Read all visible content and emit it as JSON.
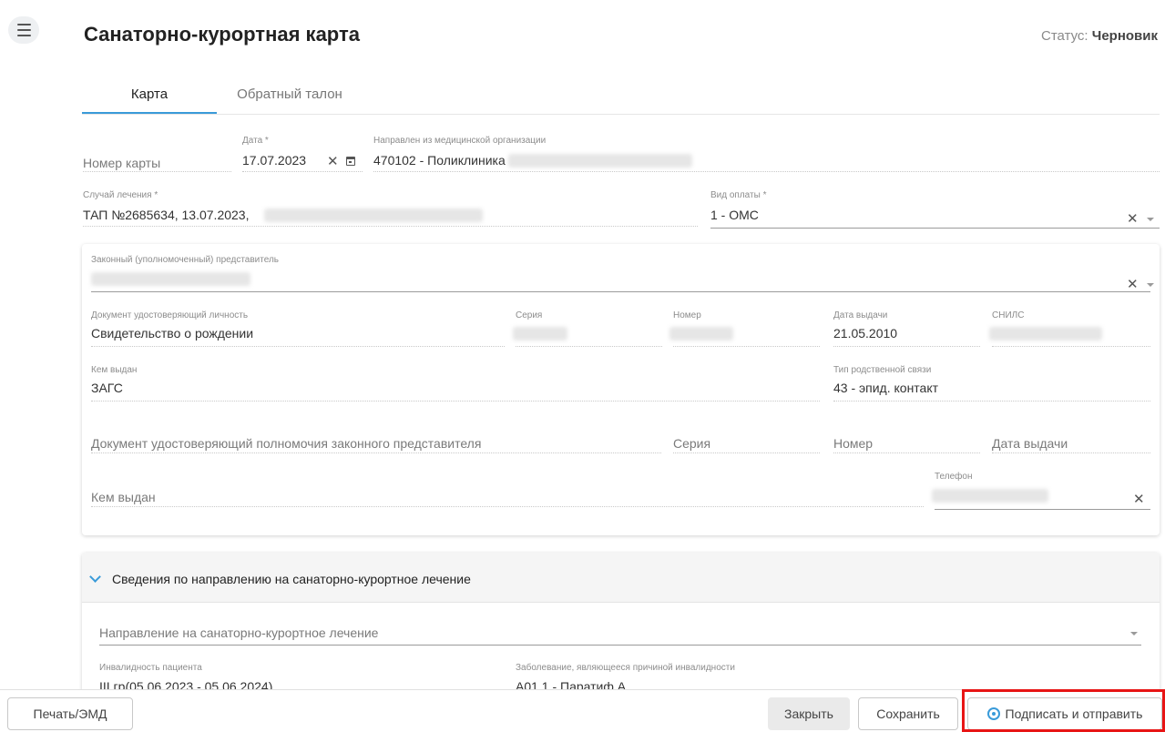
{
  "header": {
    "title": "Санаторно-курортная карта",
    "status_label": "Статус:",
    "status_value": "Черновик"
  },
  "tabs": [
    {
      "label": "Карта",
      "active": true
    },
    {
      "label": "Обратный талон",
      "active": false
    }
  ],
  "form": {
    "card_number_placeholder": "Номер карты",
    "date_label": "Дата *",
    "date_value": "17.07.2023",
    "referred_from_label": "Направлен из медицинской организации",
    "referred_from_value": "470102 - Поликлиника",
    "case_label": "Случай лечения *",
    "case_value": "ТАП №2685634, 13.07.2023,",
    "payment_label": "Вид оплаты *",
    "payment_value": "1 - ОМС"
  },
  "representative": {
    "label": "Законный (уполномоченный) представитель",
    "doc_label": "Документ удостоверяющий личность",
    "doc_value": "Свидетельство о рождении",
    "series_label": "Серия",
    "number_label": "Номер",
    "issue_date_label": "Дата выдачи",
    "issue_date_value": "21.05.2010",
    "snils_label": "СНИЛС",
    "issued_by_label": "Кем выдан",
    "issued_by_value": "ЗАГС",
    "relation_label": "Тип родственной связи",
    "relation_value": "43 - эпид. контакт",
    "authority_doc_placeholder": "Документ удостоверяющий полномочия законного представителя",
    "authority_series_placeholder": "Серия",
    "authority_number_placeholder": "Номер",
    "authority_date_placeholder": "Дата выдачи",
    "authority_issued_by_placeholder": "Кем выдан",
    "phone_label": "Телефон"
  },
  "referral_section": {
    "title": "Сведения по направлению на санаторно-курортное лечение",
    "referral_placeholder": "Направление на санаторно-курортное лечение",
    "disability_label": "Инвалидность пациента",
    "disability_value": "III гр(05.06.2023 - 05.06.2024)",
    "disease_label": "Заболевание, являющееся причиной инвалидности",
    "disease_value": "A01.1 - Паратиф А"
  },
  "footer": {
    "print_label": "Печать/ЭМД",
    "close_label": "Закрыть",
    "save_label": "Сохранить",
    "sign_label": "Подписать и отправить"
  },
  "colors": {
    "accent": "#3a9bd9",
    "highlight": "#e81515"
  }
}
